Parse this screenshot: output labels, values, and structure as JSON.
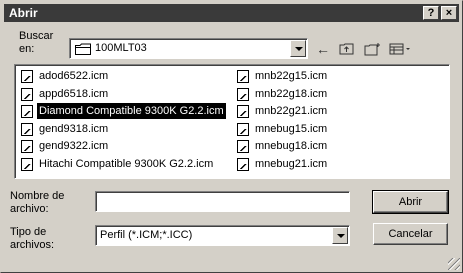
{
  "window": {
    "title": "Abrir"
  },
  "titlebar": {
    "help_label": "?",
    "close_label": "×"
  },
  "lookin": {
    "label": "Buscar en:",
    "value": "100MLT03"
  },
  "files": {
    "column1": [
      {
        "name": "adod6522.icm",
        "selected": false
      },
      {
        "name": "appd6518.icm",
        "selected": false
      },
      {
        "name": "Diamond Compatible 9300K G2.2.icm",
        "selected": true
      },
      {
        "name": "gend9318.icm",
        "selected": false
      },
      {
        "name": "gend9322.icm",
        "selected": false
      },
      {
        "name": "Hitachi Compatible 9300K G2.2.icm",
        "selected": false
      }
    ],
    "column2": [
      {
        "name": "mnb22g15.icm",
        "selected": false
      },
      {
        "name": "mnb22g18.icm",
        "selected": false
      },
      {
        "name": "mnb22g21.icm",
        "selected": false
      },
      {
        "name": "mnebug15.icm",
        "selected": false
      },
      {
        "name": "mnebug18.icm",
        "selected": false
      },
      {
        "name": "mnebug21.icm",
        "selected": false
      }
    ]
  },
  "filename": {
    "label": "Nombre de archivo:",
    "value": ""
  },
  "filetype": {
    "label": "Tipo de archivos:",
    "value": "Perfil (*.ICM;*.ICC)"
  },
  "buttons": {
    "open": "Abrir",
    "cancel": "Cancelar"
  }
}
